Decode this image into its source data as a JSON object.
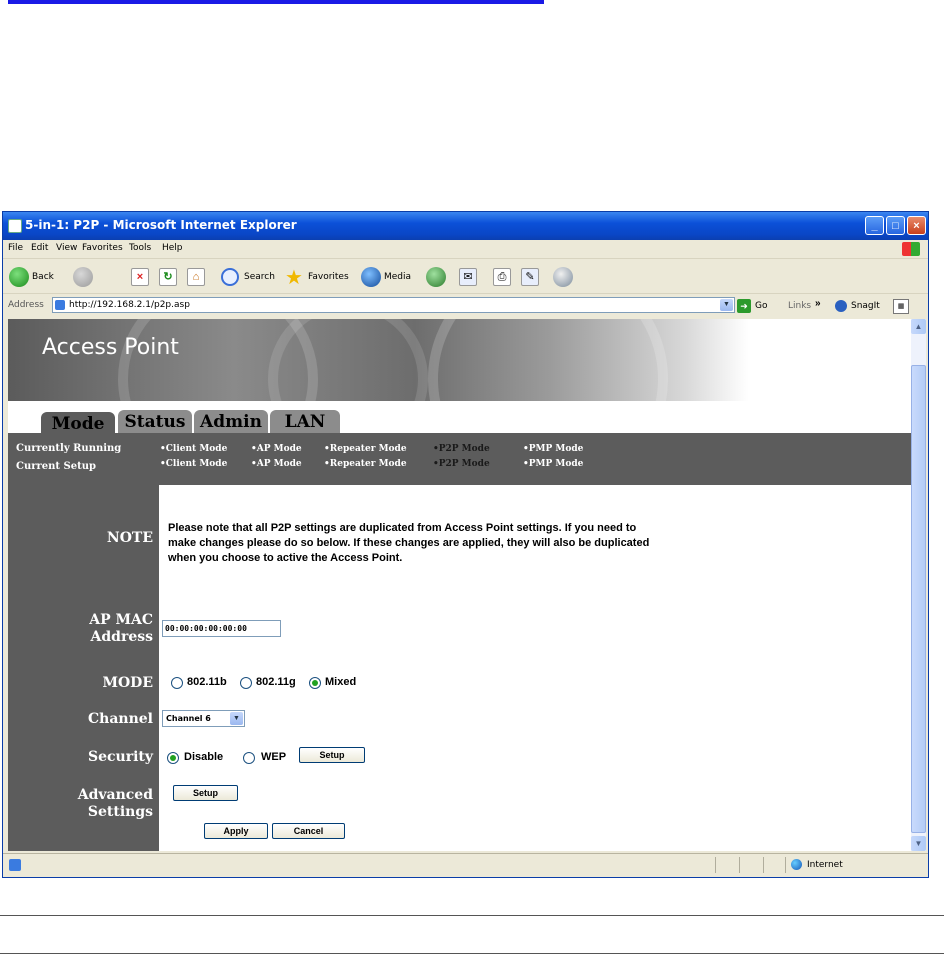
{
  "window": {
    "title": "5-in-1: P2P - Microsoft Internet Explorer",
    "minimize": "_",
    "maximize": "□",
    "close": "×"
  },
  "menu": [
    "File",
    "Edit",
    "View",
    "Favorites",
    "Tools",
    "Help"
  ],
  "toolbar": {
    "back": "Back",
    "search": "Search",
    "favorites": "Favorites",
    "media": "Media"
  },
  "address": {
    "label": "Address",
    "url": "http://192.168.2.1/p2p.asp",
    "go": "Go",
    "links": "Links",
    "links_chevron": "»",
    "snagit": "SnagIt"
  },
  "page": {
    "banner_title": "Access Point",
    "tabs": [
      {
        "label": "Mode",
        "active": true
      },
      {
        "label": "Status",
        "active": false
      },
      {
        "label": "Admin",
        "active": false
      },
      {
        "label": "LAN",
        "active": false
      }
    ],
    "status": {
      "currently_running_label": "Currently Running",
      "current_setup_label": "Current Setup",
      "running_items": [
        "•Client Mode",
        "•AP Mode",
        "•Repeater Mode",
        "•P2P Mode",
        "•PMP Mode"
      ],
      "setup_items": [
        "•Client Mode",
        "•AP Mode",
        "•Repeater Mode",
        "•P2P Mode",
        "•PMP Mode"
      ]
    },
    "labels": {
      "note": "NOTE",
      "ap_mac_line1": "AP MAC",
      "ap_mac_line2": "Address",
      "mode": "MODE",
      "channel": "Channel",
      "security": "Security",
      "advanced": "Advanced Settings"
    },
    "note_text": "Please note that all P2P settings are duplicated from Access Point settings. If you need to make changes please do so below. If these changes are applied, they will also be duplicated when you choose to active the Access Point.",
    "ap_mac_value": "00:00:00:00:00:00",
    "mode_options": [
      {
        "label": "802.11b",
        "checked": false
      },
      {
        "label": "802.11g",
        "checked": false
      },
      {
        "label": "Mixed",
        "checked": true
      }
    ],
    "channel_value": "Channel 6",
    "security_options": [
      {
        "label": "Disable",
        "checked": true
      },
      {
        "label": "WEP",
        "checked": false
      }
    ],
    "security_setup_button": "Setup",
    "advanced_setup_button": "Setup",
    "apply_button": "Apply",
    "cancel_button": "Cancel"
  },
  "statusbar": {
    "zone": "Internet"
  }
}
